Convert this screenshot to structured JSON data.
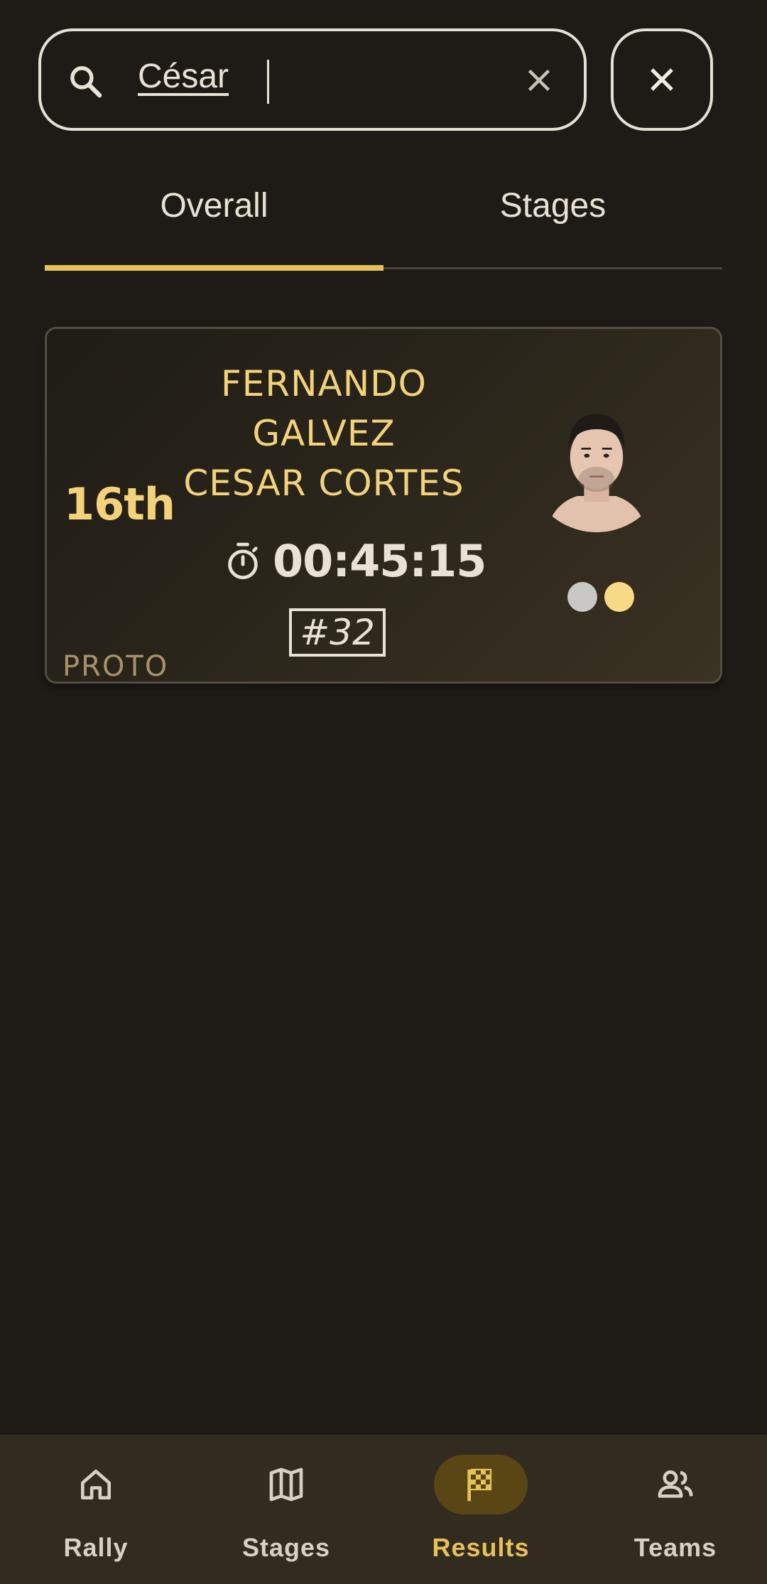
{
  "search": {
    "value": "César",
    "icon": "search-icon",
    "clear_icon": "clear-icon"
  },
  "close_button": {
    "icon": "close-icon"
  },
  "tabs": [
    {
      "label": "Overall",
      "active": true
    },
    {
      "label": "Stages",
      "active": false
    }
  ],
  "result": {
    "position": "16th",
    "crew": [
      "FERNANDO",
      "GALVEZ",
      "CESAR CORTES"
    ],
    "time": "00:45:15",
    "car_number": "#32",
    "category": "PROTO",
    "status_dots": [
      "#c9c8c6",
      "#f8d985"
    ]
  },
  "nav": [
    {
      "label": "Rally",
      "icon": "home-icon",
      "active": false
    },
    {
      "label": "Stages",
      "icon": "map-icon",
      "active": false
    },
    {
      "label": "Results",
      "icon": "checkered-flag-icon",
      "active": true
    },
    {
      "label": "Teams",
      "icon": "group-icon",
      "active": false
    }
  ],
  "colors": {
    "background": "#1e1b16",
    "accent": "#e6c15a",
    "name_text": "#f3d27a",
    "nav_background": "#322b20"
  }
}
